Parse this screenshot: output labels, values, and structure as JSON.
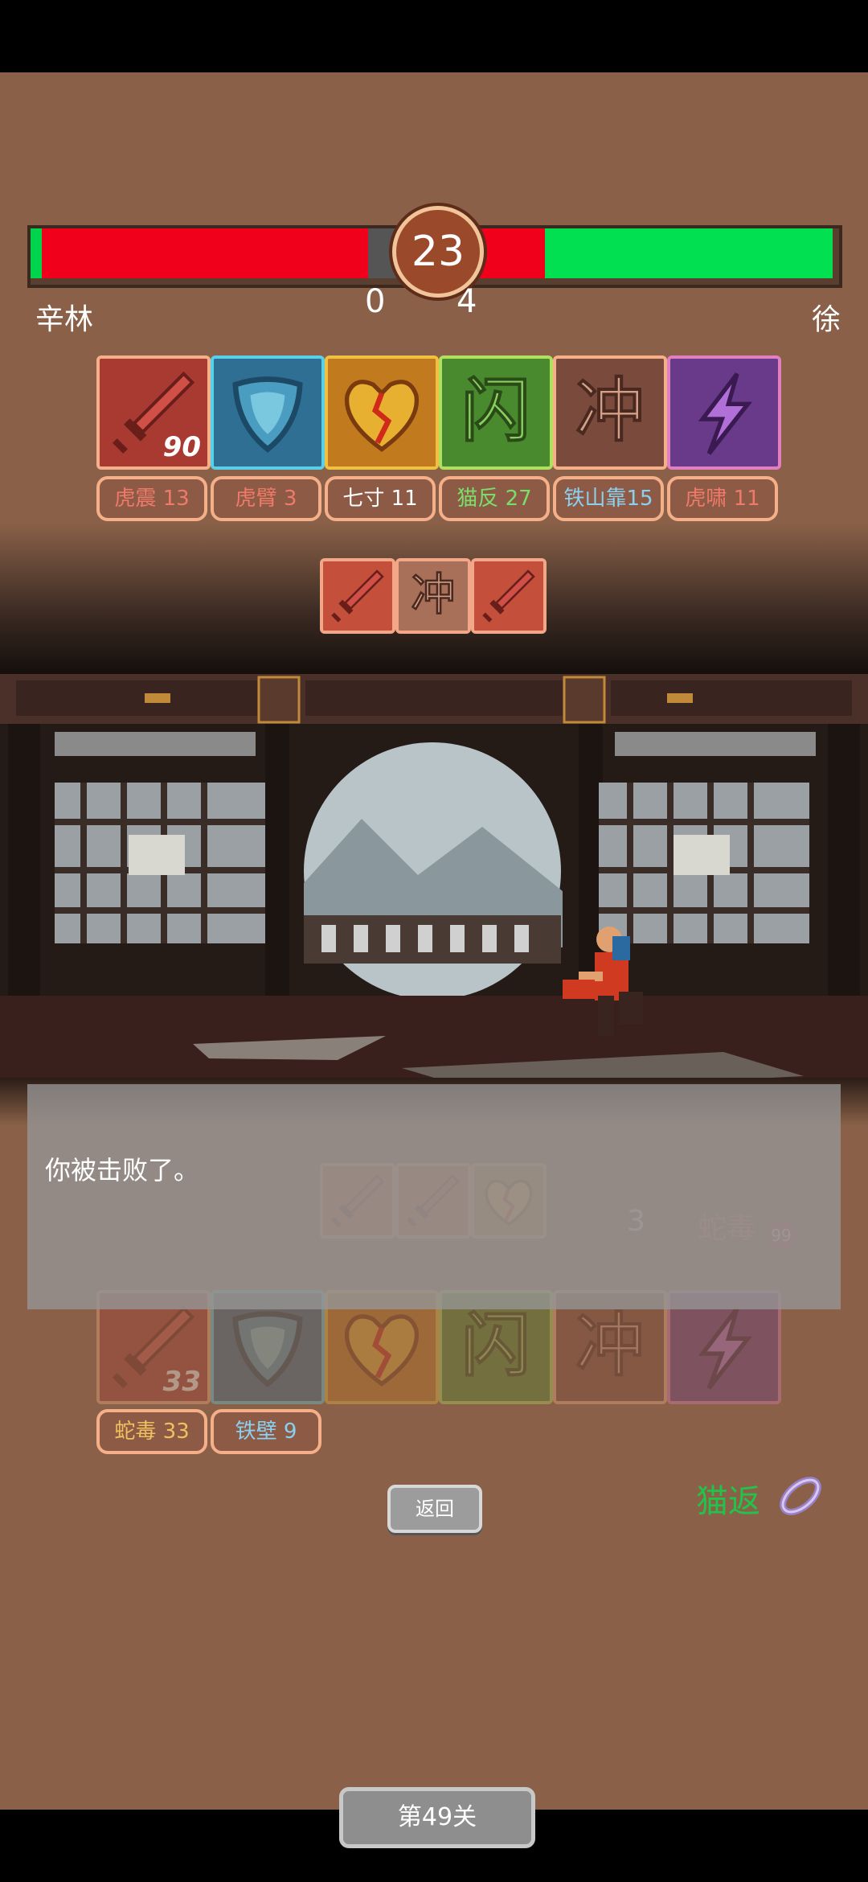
{
  "player": {
    "name": "辛林",
    "score": "0",
    "hp_fraction": 0.41
  },
  "enemy": {
    "name": "徐",
    "score": "4",
    "hp_fraction": 0.53
  },
  "round": "23",
  "enemy_skills": [
    {
      "icon": "sword-icon",
      "value": "90"
    },
    {
      "icon": "shield-icon"
    },
    {
      "icon": "broken-heart-icon"
    },
    {
      "icon": "dodge-icon",
      "glyph": "闪"
    },
    {
      "icon": "charge-icon",
      "glyph": "冲"
    },
    {
      "icon": "lightning-icon"
    }
  ],
  "enemy_buffs": [
    {
      "label": "虎震 13",
      "color": "#f07a6a"
    },
    {
      "label": "虎臂  3",
      "color": "#f07a6a"
    },
    {
      "label": "七寸 11",
      "color": "#ffffff"
    },
    {
      "label": "猫反 27",
      "color": "#7adf6a"
    },
    {
      "label": "铁山靠15",
      "color": "#8ad0f0"
    },
    {
      "label": "虎啸 11",
      "color": "#f07a6a"
    }
  ],
  "enemy_combo": [
    {
      "icon": "sword-icon"
    },
    {
      "icon": "charge-icon",
      "glyph": "冲"
    },
    {
      "icon": "sword-icon"
    }
  ],
  "player_combo": [
    {
      "icon": "sword-icon"
    },
    {
      "icon": "sword-icon"
    },
    {
      "icon": "broken-heart-icon"
    }
  ],
  "player_status": {
    "count": "3",
    "poison_label": "蛇毒",
    "poison_badge": "99"
  },
  "player_skills": [
    {
      "icon": "sword-icon",
      "value": "33"
    },
    {
      "icon": "shield-icon"
    },
    {
      "icon": "broken-heart-icon"
    },
    {
      "icon": "dodge-icon",
      "glyph": "闪"
    },
    {
      "icon": "charge-icon",
      "glyph": "冲"
    },
    {
      "icon": "lightning-icon"
    }
  ],
  "player_buffs": [
    {
      "label": "蛇毒 33",
      "color": "#f0c060"
    },
    {
      "label": "铁壁  9",
      "color": "#8ad0f0"
    }
  ],
  "dialog": {
    "message": "你被击败了。"
  },
  "return_button": "返回",
  "counter_label": "猫返",
  "level_button": "第49关"
}
